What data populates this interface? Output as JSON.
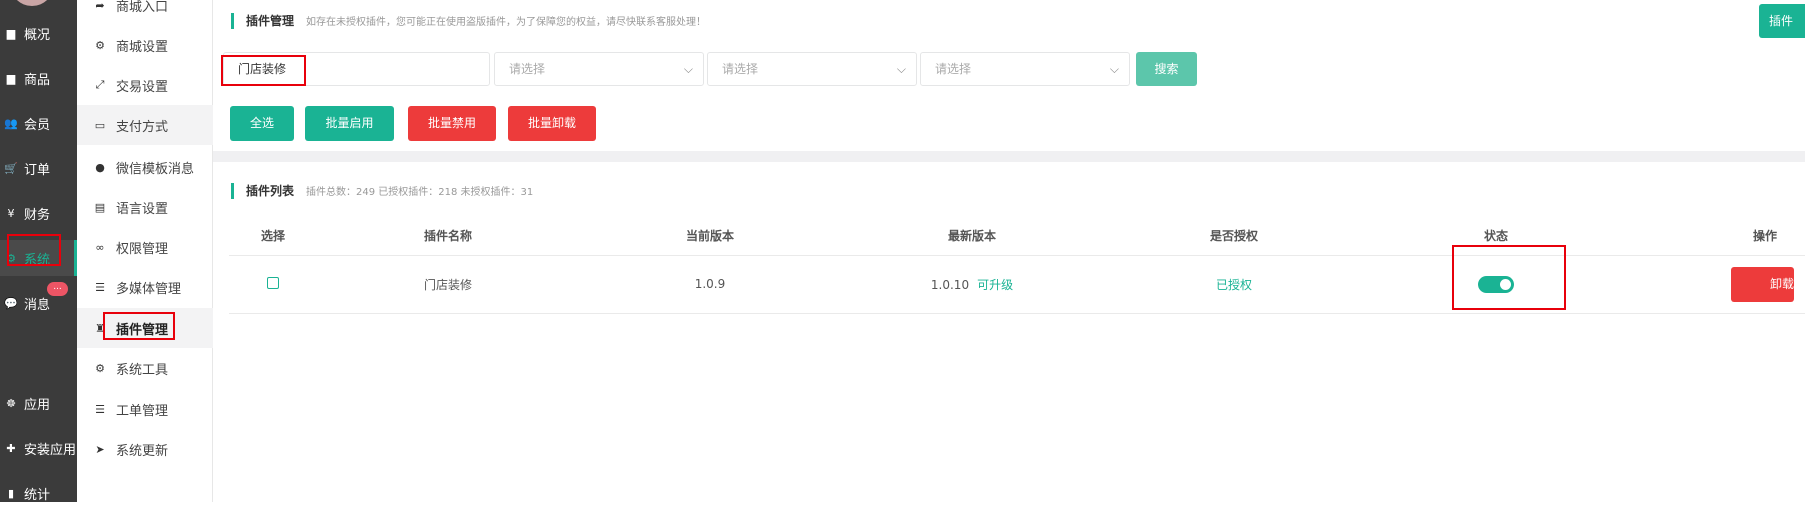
{
  "nav_primary": [
    {
      "label": "概况",
      "icon": "dashboard-icon"
    },
    {
      "label": "商品",
      "icon": "goods-icon"
    },
    {
      "label": "会员",
      "icon": "users-icon"
    },
    {
      "label": "订单",
      "icon": "cart-icon"
    },
    {
      "label": "财务",
      "icon": "yen-icon"
    },
    {
      "label": "系统",
      "icon": "system-icon",
      "active": true
    },
    {
      "label": "消息",
      "icon": "message-icon"
    },
    {
      "label": "应用",
      "icon": "apps-icon"
    },
    {
      "label": "安装应用",
      "icon": "plugin-install-icon"
    },
    {
      "label": "统计",
      "icon": "stats-icon"
    }
  ],
  "message_badge": "...",
  "nav_secondary": [
    {
      "label": "商城入口",
      "icon": "entry-icon"
    },
    {
      "label": "商城设置",
      "icon": "gear-icon"
    },
    {
      "label": "交易设置",
      "icon": "trade-icon"
    },
    {
      "label": "支付方式",
      "icon": "credit-card-icon"
    },
    {
      "label": "微信模板消息",
      "icon": "wechat-icon"
    },
    {
      "label": "语言设置",
      "icon": "language-icon"
    },
    {
      "label": "权限管理",
      "icon": "permission-icon"
    },
    {
      "label": "多媒体管理",
      "icon": "list-icon"
    },
    {
      "label": "插件管理",
      "icon": "plugin-icon",
      "active": true
    },
    {
      "label": "系统工具",
      "icon": "tools-icon"
    },
    {
      "label": "工单管理",
      "icon": "list-icon"
    },
    {
      "label": "系统更新",
      "icon": "send-icon"
    }
  ],
  "header": {
    "title": "插件管理",
    "notice": "如存在未授权插件，您可能正在使用盗版插件，为了保障您的权益，请尽快联系客服处理！",
    "top_right_button": "插件"
  },
  "filters": {
    "keyword_value": "门店装修",
    "select1_placeholder": "请选择",
    "select2_placeholder": "请选择",
    "select3_placeholder": "请选择",
    "search_label": "搜索"
  },
  "actions": {
    "select_all": "全选",
    "batch_enable": "批量启用",
    "batch_disable": "批量禁用",
    "batch_uninstall": "批量卸载"
  },
  "list": {
    "title": "插件列表",
    "summary": "插件总数：249 已授权插件：218 未授权插件：31",
    "columns": [
      "选择",
      "插件名称",
      "当前版本",
      "最新版本",
      "是否授权",
      "状态",
      "操作"
    ],
    "rows": [
      {
        "name": "门店装修",
        "current_version": "1.0.9",
        "latest_version": "1.0.10",
        "upgrade_label": "可升级",
        "authorized": "已授权",
        "enabled": true,
        "action": "卸载"
      }
    ]
  },
  "colors": {
    "accent": "#1ab394",
    "danger": "#ed3b3b",
    "sidebar": "#3b3b3b",
    "annotation": "#e8000b"
  }
}
